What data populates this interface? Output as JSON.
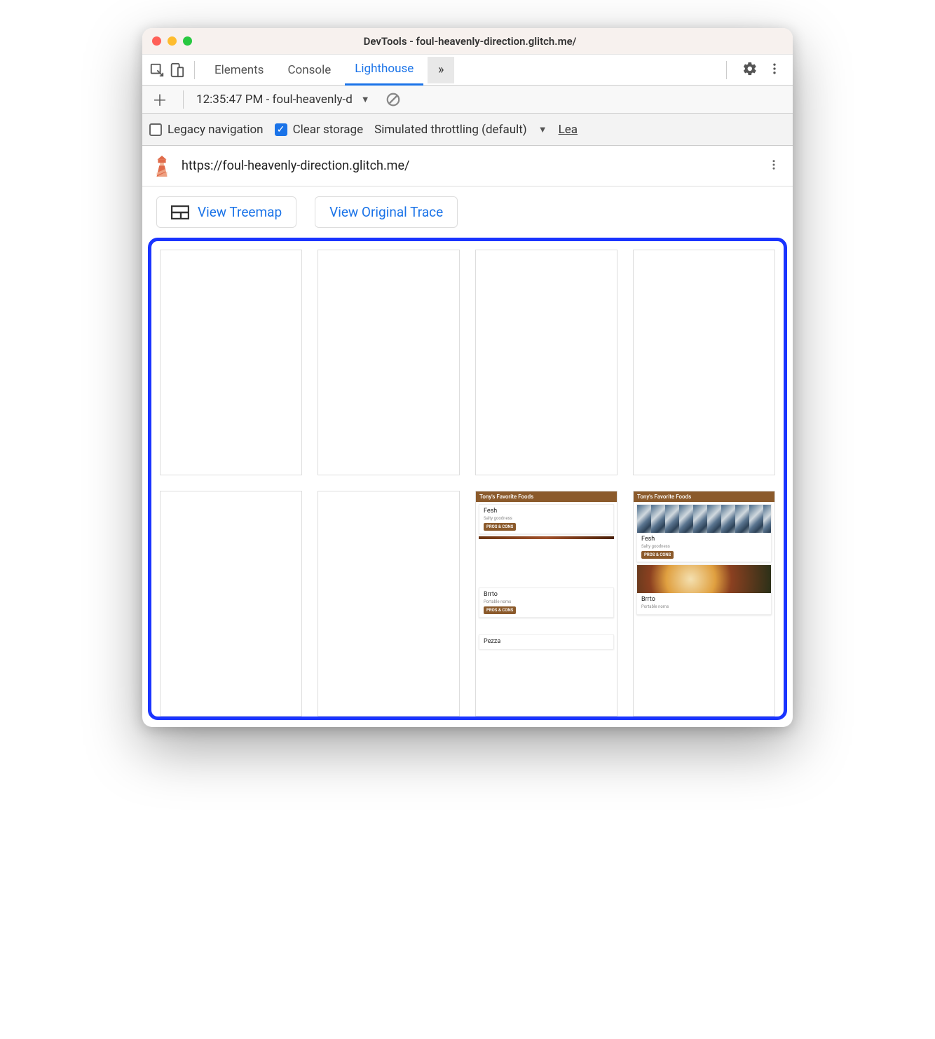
{
  "window": {
    "title": "DevTools - foul-heavenly-direction.glitch.me/"
  },
  "tabs": {
    "elements": "Elements",
    "console": "Console",
    "lighthouse": "Lighthouse"
  },
  "report_picker": {
    "label": "12:35:47 PM - foul-heavenly-d"
  },
  "options": {
    "legacy_label": "Legacy navigation",
    "legacy_checked": false,
    "clear_label": "Clear storage",
    "clear_checked": true,
    "throttling": "Simulated throttling (default)",
    "learn": "Lea"
  },
  "url": "https://foul-heavenly-direction.glitch.me/",
  "buttons": {
    "treemap": "View Treemap",
    "trace": "View Original Trace"
  },
  "thumb": {
    "header": "Tony's Favorite Foods",
    "items": [
      {
        "title": "Fesh",
        "sub": "Salty goodness",
        "badge": "PROS & CONS"
      },
      {
        "title": "Brrto",
        "sub": "Portable noms",
        "badge": "PROS & CONS"
      },
      {
        "title": "Pezza",
        "sub": "",
        "badge": ""
      }
    ]
  }
}
